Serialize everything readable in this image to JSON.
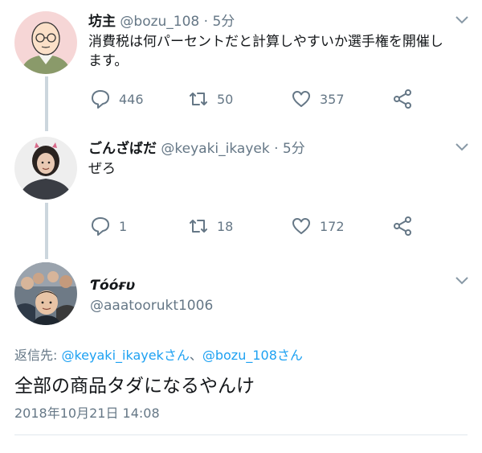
{
  "tweet1": {
    "name": "坊主",
    "handle": "@bozu_108",
    "sep": "·",
    "time": "5分",
    "text_line1": "消費税は何パーセントだと計算しやすいか選手権を開催し",
    "text_line2": "ます。",
    "replies": "446",
    "retweets": "50",
    "likes": "357"
  },
  "tweet2": {
    "name": "ごんざばだ",
    "handle": "@keyaki_ikayek",
    "sep": "·",
    "time": "5分",
    "text": "ぜろ",
    "replies": "1",
    "retweets": "18",
    "likes": "172"
  },
  "tweet3": {
    "name": "Ƭόόғυ",
    "handle": "@aaatoorukt1006",
    "reply_prefix": "返信先: ",
    "mention1": "@keyaki_ikayekさん",
    "reply_joiner": "、",
    "mention2": "@bozu_108さん",
    "text": "全部の商品タダになるやんけ",
    "date": "2018年10月21日 14:08"
  },
  "colors": {
    "accent": "#1da1f2",
    "muted": "#657786",
    "thread_line": "#ccd6dd"
  },
  "icons": [
    "reply-icon",
    "retweet-icon",
    "like-icon",
    "share-icon",
    "chevron-down-icon"
  ]
}
